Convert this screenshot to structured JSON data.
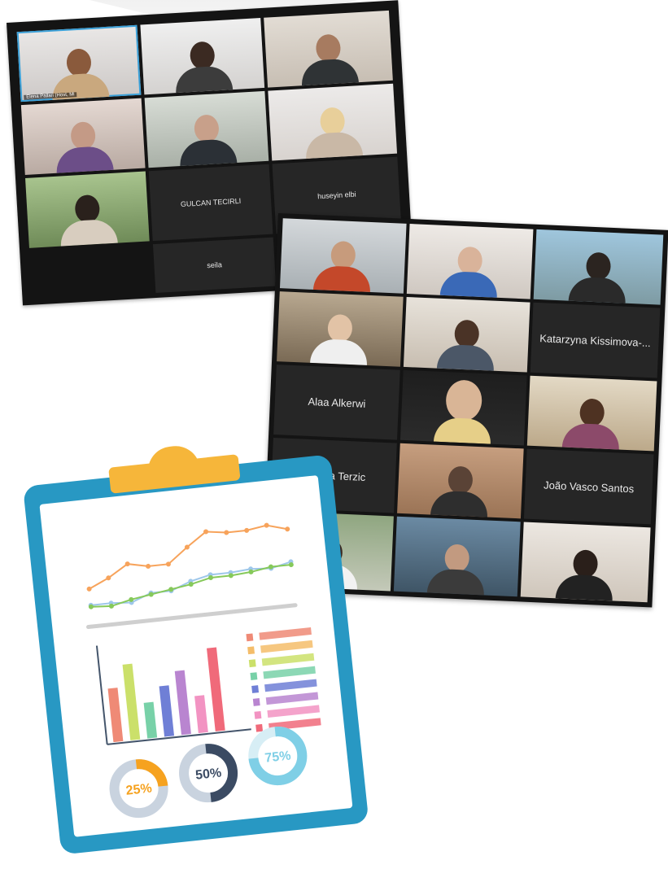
{
  "screen1": {
    "active_label": "Elena Pallari (Host, Mi",
    "name_tiles": [
      "GULCAN TECIRLI",
      "huseyin elbi",
      "seila"
    ]
  },
  "screen2": {
    "name_tiles": [
      "Katarzyna Kissimova-...",
      "Alaa Alkerwi",
      "Natasa Terzic",
      "João Vasco Santos"
    ]
  },
  "clipboard": {
    "colors": {
      "board": "#2898c3",
      "clip": "#f6b63a",
      "orange": "#f7a35b",
      "blue": "#9ec7ea",
      "green": "#86c95a"
    },
    "line_chart": {
      "type": "line",
      "series": [
        {
          "values": [
            2.2,
            2.8,
            3.6,
            3.3,
            3.3,
            4.3,
            5.2,
            5.0,
            5.0,
            5.2,
            4.8
          ]
        },
        {
          "values": [
            1.1,
            1.1,
            1.0,
            1.5,
            1.5,
            2.0,
            2.3,
            2.3,
            2.4,
            2.3,
            2.6
          ]
        },
        {
          "values": [
            1.0,
            0.9,
            1.2,
            1.4,
            1.6,
            1.8,
            2.1,
            2.1,
            2.2,
            2.4,
            2.4
          ]
        }
      ]
    },
    "bar_chart": {
      "type": "bar",
      "values": [
        7.2,
        10.2,
        4.8,
        6.8,
        8.6,
        5.0,
        11.2
      ],
      "colors": [
        "#ef8a76",
        "#cbe06a",
        "#78d1a8",
        "#6f7fd6",
        "#b985d0",
        "#f293c2",
        "#f06a7a"
      ]
    },
    "hbars": {
      "colors": [
        "#ef8a76",
        "#f4bd6a",
        "#cbe06a",
        "#78d1a8",
        "#6f7fd6",
        "#b985d0",
        "#f293c2",
        "#f06a7a"
      ]
    },
    "donuts": [
      {
        "label": "25%",
        "value": 25,
        "color": "#f6a21f",
        "track": "#c9d3df"
      },
      {
        "label": "50%",
        "value": 50,
        "color": "#3b4b63",
        "track": "#c9d3df"
      },
      {
        "label": "75%",
        "value": 75,
        "color": "#7fcfe6",
        "track": "#d7eef5"
      }
    ]
  }
}
